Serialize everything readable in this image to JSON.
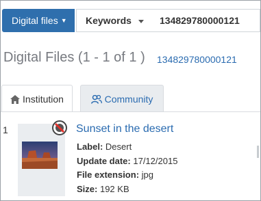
{
  "search": {
    "scope_label": "Digital files",
    "field_label": "Keywords",
    "query_value": "134829780000121"
  },
  "heading": {
    "title": "Digital Files (1 - 1 of 1 )",
    "link_text": "134829780000121"
  },
  "tabs": [
    {
      "label": "Institution",
      "icon": "home-icon",
      "active": true
    },
    {
      "label": "Community",
      "icon": "users-icon",
      "active": false
    }
  ],
  "result": {
    "number": "1",
    "title": "Sunset in the desert",
    "label_key": "Label:",
    "label_value": "Desert",
    "date_key": "Update date:",
    "date_value": "17/12/2015",
    "ext_key": "File extension:",
    "ext_value": "jpg",
    "size_key": "Size:",
    "size_value": "192 KB",
    "status_icon": "no-download-icon",
    "thumbnail_icon": "desert-thumbnail-image"
  },
  "colors": {
    "primary": "#2f6fad",
    "link": "#2a6bb0",
    "muted_heading": "#777a80",
    "tab_inactive_bg": "#e9ecef",
    "thumb_card_bg": "#eaedf0"
  }
}
